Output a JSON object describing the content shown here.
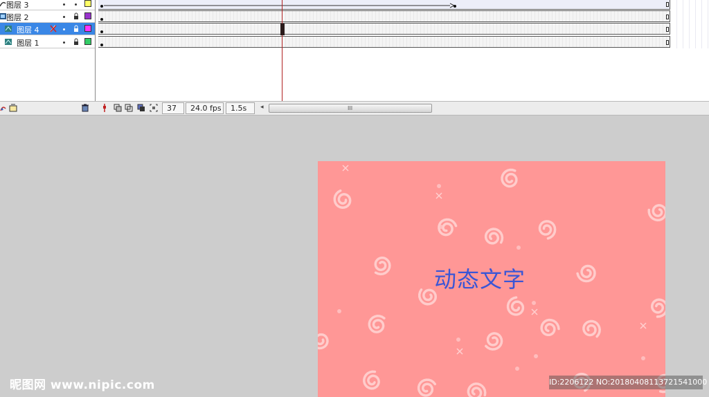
{
  "timeline": {
    "layers": [
      {
        "name": "图层 3",
        "color": "#ffff66",
        "selected": false,
        "locked": false
      },
      {
        "name": "图层 2",
        "color": "#9933cc",
        "selected": false,
        "locked": true
      },
      {
        "name": "图层 4",
        "color": "#ff33ff",
        "selected": true,
        "locked": true
      },
      {
        "name": "图层 1",
        "color": "#33cc66",
        "selected": false,
        "locked": true
      }
    ],
    "status": {
      "current_frame": "37",
      "fps": "24.0 fps",
      "elapsed": "1.5s",
      "scroll_grip": "III"
    },
    "icons": {
      "add_layer": "add-layer-icon",
      "delete_layer": "trash-icon",
      "center_frame": "center-frame-icon",
      "onion_skin": "onion-skin-icon"
    },
    "colors": {
      "selected_row": "#3a87e6",
      "playhead": "#b02020"
    }
  },
  "stage": {
    "canvas_text": "动态文字",
    "canvas_bg": "#ff9796",
    "text_color": "#3a56d6"
  },
  "watermarks": {
    "left": "昵图网 www.nipic.com",
    "right": "ID:2206122 NO:20180408113721541000"
  }
}
